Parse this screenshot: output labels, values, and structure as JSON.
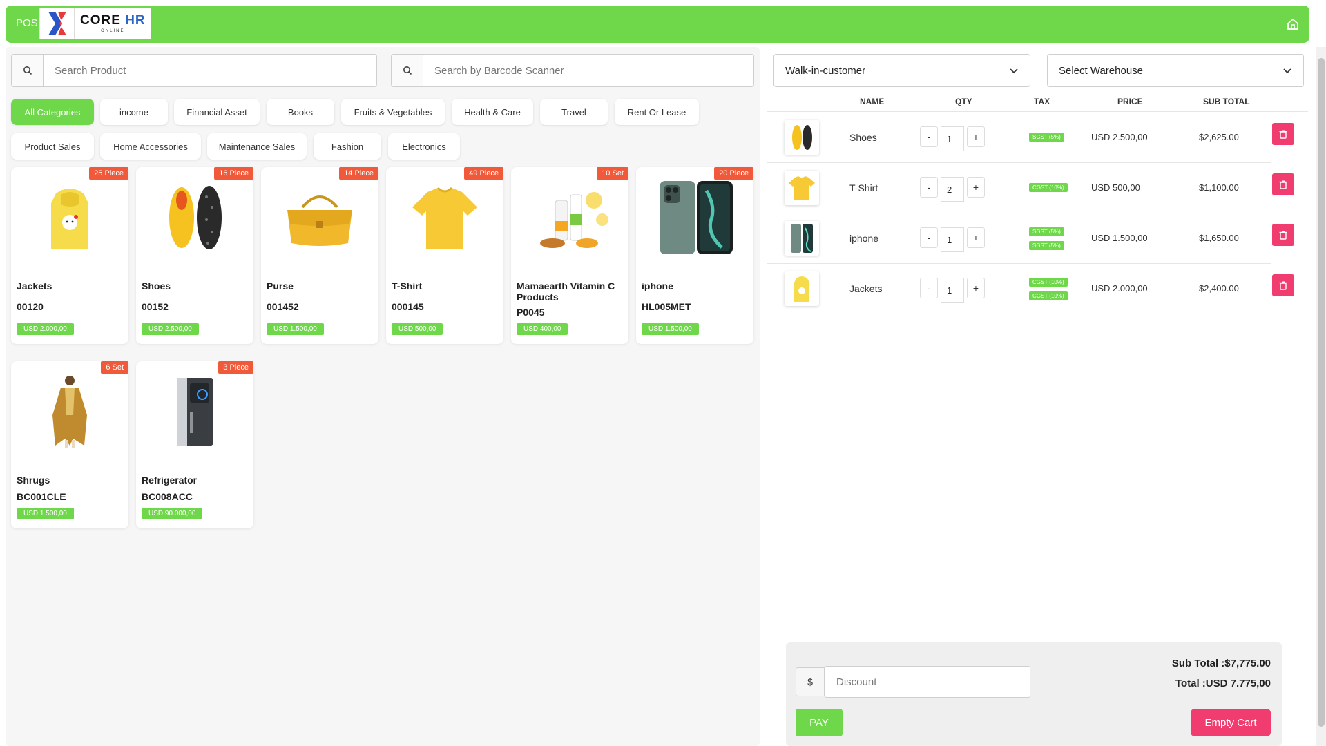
{
  "header": {
    "pos_label": "POS",
    "logo_title_core": "CORE",
    "logo_title_hr": "HR",
    "logo_sub": "ONLINE",
    "brand_color": "#6fd84a"
  },
  "search": {
    "product_placeholder": "Search Product",
    "barcode_placeholder": "Search by Barcode Scanner"
  },
  "categories": [
    {
      "label": "All Categories",
      "active": true
    },
    {
      "label": "income"
    },
    {
      "label": "Financial Asset"
    },
    {
      "label": "Books"
    },
    {
      "label": "Fruits & Vegetables"
    },
    {
      "label": "Health & Care"
    },
    {
      "label": "Travel"
    },
    {
      "label": "Rent Or Lease"
    },
    {
      "label": "Product Sales"
    },
    {
      "label": "Home Accessories"
    },
    {
      "label": "Maintenance Sales"
    },
    {
      "label": "Fashion"
    },
    {
      "label": "Electronics"
    }
  ],
  "products": [
    {
      "name": "Jackets",
      "code": "00120",
      "price": "USD 2.000,00",
      "stock": "25 Piece",
      "icon": "yellow-hoodie-image"
    },
    {
      "name": "Shoes",
      "code": "00152",
      "price": "USD 2.500,00",
      "stock": "16 Piece",
      "icon": "yellow-shoes-image"
    },
    {
      "name": "Purse",
      "code": "001452",
      "price": "USD 1.500,00",
      "stock": "14 Piece",
      "icon": "yellow-purse-image"
    },
    {
      "name": "T-Shirt",
      "code": "000145",
      "price": "USD 500,00",
      "stock": "49 Piece",
      "icon": "yellow-tshirt-image"
    },
    {
      "name": "Mamaearth Vitamin C Products",
      "code": "P0045",
      "price": "USD 400,00",
      "stock": "10 Set",
      "icon": "vitamin-products-image"
    },
    {
      "name": "iphone",
      "code": "HL005MET",
      "price": "USD 1.500,00",
      "stock": "20 Piece",
      "icon": "iphone-image"
    },
    {
      "name": "Shrugs",
      "code": "BC001CLE",
      "price": "USD 1.500,00",
      "stock": "6 Set",
      "icon": "shrug-dress-image"
    },
    {
      "name": "Refrigerator",
      "code": "BC008ACC",
      "price": "USD 90.000,00",
      "stock": "3 Piece",
      "icon": "refrigerator-image"
    }
  ],
  "customer_select": "Walk-in-customer",
  "warehouse_select": "Select Warehouse",
  "table_headers": {
    "name": "NAME",
    "qty": "QTY",
    "tax": "TAX",
    "price": "PRICE",
    "subtotal": "SUB TOTAL"
  },
  "cart": [
    {
      "name": "Shoes",
      "qty": "1",
      "taxes": [
        "SGST (5%)"
      ],
      "price": "USD 2.500,00",
      "subtotal": "$2,625.00"
    },
    {
      "name": "T-Shirt",
      "qty": "2",
      "taxes": [
        "CGST (10%)"
      ],
      "price": "USD 500,00",
      "subtotal": "$1,100.00"
    },
    {
      "name": "iphone",
      "qty": "1",
      "taxes": [
        "SGST (5%)",
        "SGST (5%)"
      ],
      "price": "USD 1.500,00",
      "subtotal": "$1,650.00"
    },
    {
      "name": "Jackets",
      "qty": "1",
      "taxes": [
        "CGST (10%)",
        "CGST (10%)"
      ],
      "price": "USD 2.000,00",
      "subtotal": "$2,400.00"
    }
  ],
  "qty_minus": "-",
  "qty_plus": "+",
  "footer": {
    "currency_symbol": "$",
    "discount_placeholder": "Discount",
    "sub_total": "Sub Total :$7,775.00",
    "total": "Total :USD 7.775,00",
    "pay_label": "PAY",
    "empty_label": "Empty Cart"
  }
}
